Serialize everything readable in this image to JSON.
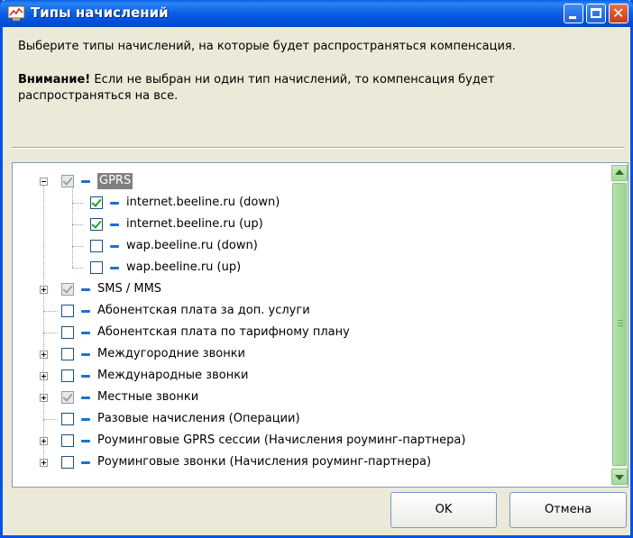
{
  "window": {
    "title": "Типы начислений",
    "close_glyph": "✕",
    "controls": [
      "minimize-icon",
      "maximize-icon",
      "close-icon"
    ]
  },
  "description": "Выберите типы начислений, на которые будет распространяться компенсация.",
  "warning": {
    "bold": "Внимание!",
    "line1": " Если не выбран ни один тип начислений, то компенсация будет",
    "line2": "распространяться на все."
  },
  "tree": {
    "items": [
      {
        "label": "GPRS",
        "level": 0,
        "expander": "minus",
        "check": "partial",
        "selected": true
      },
      {
        "label": "internet.beeline.ru (down)",
        "level": 1,
        "check": "checked"
      },
      {
        "label": "internet.beeline.ru (up)",
        "level": 1,
        "check": "checked"
      },
      {
        "label": "wap.beeline.ru (down)",
        "level": 1,
        "check": "unchecked"
      },
      {
        "label": "wap.beeline.ru (up)",
        "level": 1,
        "check": "unchecked"
      },
      {
        "label": "SMS / MMS",
        "level": 0,
        "expander": "plus",
        "check": "partial"
      },
      {
        "label": "Абонентская плата за доп. услуги",
        "level": 0,
        "check": "unchecked"
      },
      {
        "label": "Абонентская плата по тарифному плану",
        "level": 0,
        "check": "unchecked"
      },
      {
        "label": "Междугородние звонки",
        "level": 0,
        "expander": "plus",
        "check": "unchecked"
      },
      {
        "label": "Международные звонки",
        "level": 0,
        "expander": "plus",
        "check": "unchecked"
      },
      {
        "label": "Местные звонки",
        "level": 0,
        "expander": "plus",
        "check": "partial"
      },
      {
        "label": "Разовые начисления (Операции)",
        "level": 0,
        "check": "unchecked"
      },
      {
        "label": "Роуминговые GPRS сессии (Начисления роуминг-партнера)",
        "level": 0,
        "expander": "plus",
        "check": "unchecked"
      },
      {
        "label": "Роуминговые звонки (Начисления роуминг-партнера)",
        "level": 0,
        "expander": "plus",
        "check": "unchecked"
      }
    ]
  },
  "buttons": {
    "ok": "OK",
    "cancel": "Отмена"
  },
  "colors": {
    "titlebar": "#0054e3",
    "dialog_bg": "#ece9d8",
    "checkmark": "#21a121",
    "selection": "#808080",
    "scrollbar": "#a4d89a"
  }
}
